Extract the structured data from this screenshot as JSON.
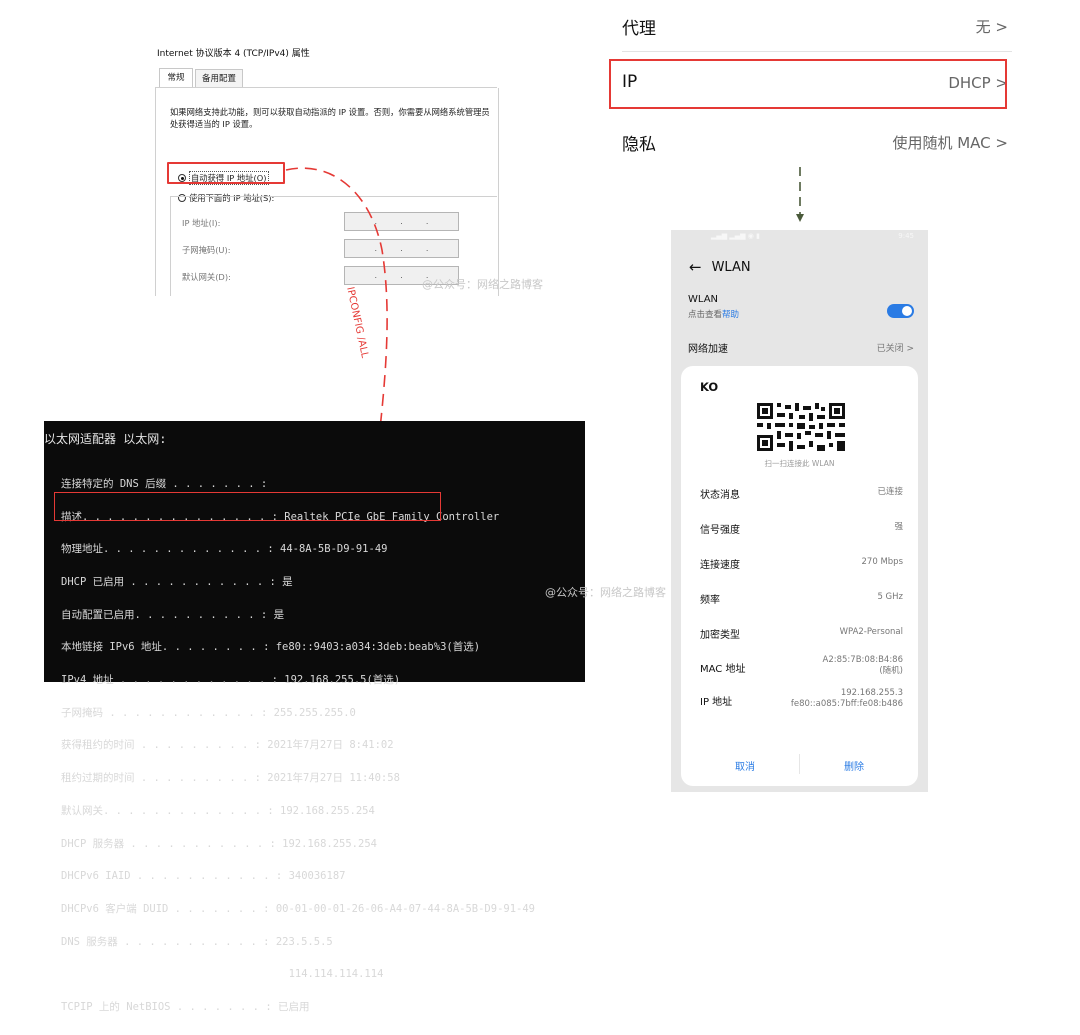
{
  "windows_dialog": {
    "title": "Internet 协议版本 4 (TCP/IPv4) 属性",
    "tabs": [
      "常规",
      "备用配置"
    ],
    "description": "如果网络支持此功能，则可以获取自动指派的 IP 设置。否则，你需要从网络系统管理员处获得适当的 IP 设置。",
    "radio_auto": "自动获得 IP 地址(O)",
    "radio_manual": "使用下面的 IP 地址(S):",
    "fields": [
      {
        "label": "IP 地址(I):",
        "dots": ". . ."
      },
      {
        "label": "子网掩码(U):",
        "dots": ". . ."
      },
      {
        "label": "默认网关(D):",
        "dots": ". . ."
      }
    ]
  },
  "annotations": {
    "ipconfig_label": "IPCONFIG /ALL",
    "watermark_1": "@公众号：网络之路博客",
    "watermark_2": "@公众号：网络之路博客",
    "accent_color": "#e53935"
  },
  "console": {
    "title": "以太网适配器 以太网:",
    "lines": [
      "连接特定的 DNS 后缀 . . . . . . . :",
      "描述. . . . . . . . . . . . . . . : Realtek PCIe GbE Family Controller",
      "物理地址. . . . . . . . . . . . . : 44-8A-5B-D9-91-49",
      "DHCP 已启用 . . . . . . . . . . . : 是",
      "自动配置已启用. . . . . . . . . . : 是",
      "本地链接 IPv6 地址. . . . . . . . : fe80::9403:a034:3deb:beab%3(首选)",
      "IPv4 地址 . . . . . . . . . . . . : 192.168.255.5(首选)",
      "子网掩码 . . . . . . . . . . . . : 255.255.255.0",
      "获得租约的时间 . . . . . . . . . : 2021年7月27日 8:41:02",
      "租约过期的时间 . . . . . . . . . : 2021年7月27日 11:40:58",
      "默认网关. . . . . . . . . . . . . : 192.168.255.254",
      "DHCP 服务器 . . . . . . . . . . . : 192.168.255.254",
      "DHCPv6 IAID . . . . . . . . . . . : 340036187",
      "DHCPv6 客户端 DUID . . . . . . . : 00-01-00-01-26-06-A4-07-44-8A-5B-D9-91-49",
      "DNS 服务器 . . . . . . . . . . . : 223.5.5.5",
      "                                    114.114.114.114",
      "TCPIP 上的 NetBIOS . . . . . . . : 已启用"
    ]
  },
  "settings": {
    "rows": [
      {
        "key": "代理",
        "value": "无 >"
      },
      {
        "key": "IP",
        "value": "DHCP >"
      },
      {
        "key": "隐私",
        "value": "使用随机 MAC >"
      }
    ]
  },
  "phone": {
    "status_time": "9:45",
    "header": "WLAN",
    "wlan_label": "WLAN",
    "help_prefix": "点击查看",
    "help_link": "帮助",
    "wlan_on": true,
    "accel_label": "网络加速",
    "accel_value": "已关闭 >",
    "card": {
      "ssid": "KO",
      "qr_caption": "扫一扫连接此 WLAN",
      "rows": [
        {
          "key": "状态消息",
          "value": "已连接"
        },
        {
          "key": "信号强度",
          "value": "强"
        },
        {
          "key": "连接速度",
          "value": "270 Mbps"
        },
        {
          "key": "频率",
          "value": "5 GHz"
        },
        {
          "key": "加密类型",
          "value": "WPA2-Personal"
        },
        {
          "key": "MAC 地址",
          "value": "A2:85:7B:08:B4:86",
          "value2": "(随机)"
        },
        {
          "key": "IP 地址",
          "value": "192.168.255.3",
          "value2": "fe80::a085:7bff:fe08:b486"
        }
      ],
      "cancel": "取消",
      "delete": "删除"
    }
  }
}
